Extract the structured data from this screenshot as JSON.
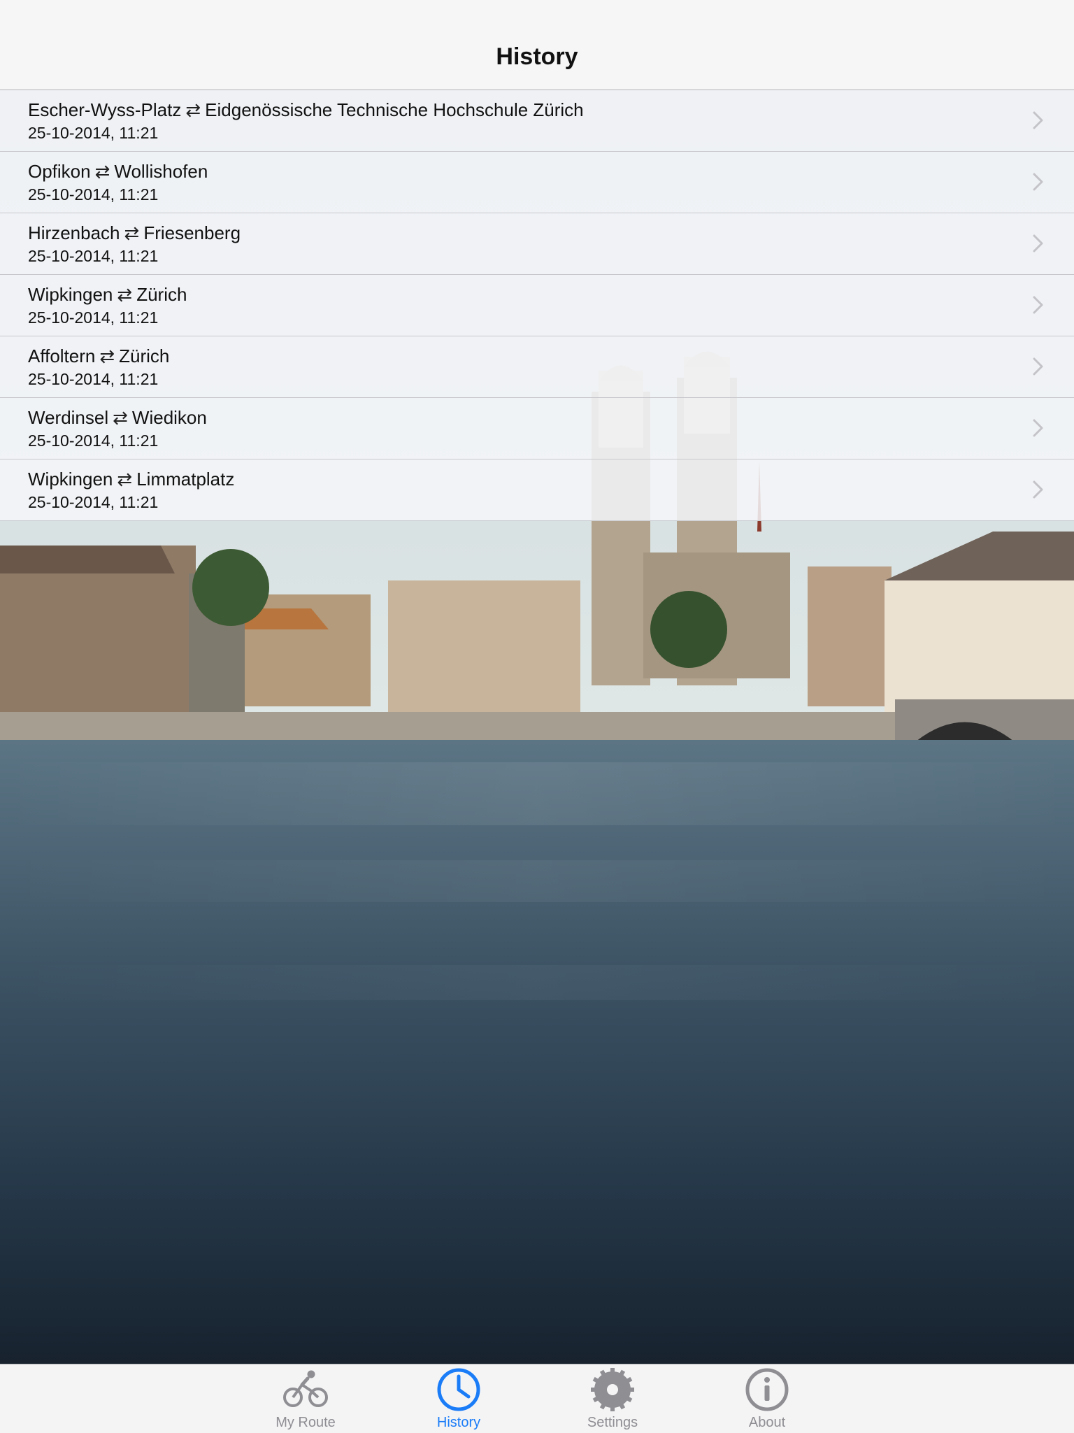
{
  "nav": {
    "title": "History"
  },
  "history": [
    {
      "from": "Escher-Wyss-Platz",
      "to": "Eidgenössische Technische Hochschule Zürich",
      "arrows": "⇄",
      "date": "25-10-2014, 11:21"
    },
    {
      "from": "Opfikon",
      "to": "Wollishofen",
      "arrows": "⇄",
      "date": "25-10-2014, 11:21"
    },
    {
      "from": "Hirzenbach",
      "to": "Friesenberg",
      "arrows": "⇄",
      "date": "25-10-2014, 11:21"
    },
    {
      "from": "Wipkingen",
      "to": "Zürich",
      "arrows": "⇄",
      "date": "25-10-2014, 11:21"
    },
    {
      "from": "Affoltern",
      "to": "Zürich",
      "arrows": "⇄",
      "date": "25-10-2014, 11:21"
    },
    {
      "from": "Werdinsel",
      "to": "Wiedikon",
      "arrows": "⇄",
      "date": "25-10-2014, 11:21"
    },
    {
      "from": "Wipkingen",
      "to": "Limmatplatz",
      "arrows": "⇄",
      "date": "25-10-2014, 11:21"
    }
  ],
  "tabbar": {
    "tabs": [
      {
        "label": "My Route",
        "icon": "bicycle-icon",
        "active": false
      },
      {
        "label": "History",
        "icon": "clock-icon",
        "active": true
      },
      {
        "label": "Settings",
        "icon": "gear-icon",
        "active": false
      },
      {
        "label": "About",
        "icon": "info-icon",
        "active": false
      }
    ]
  },
  "colors": {
    "accent": "#1a7cf7",
    "inactive": "#8e8e93"
  }
}
